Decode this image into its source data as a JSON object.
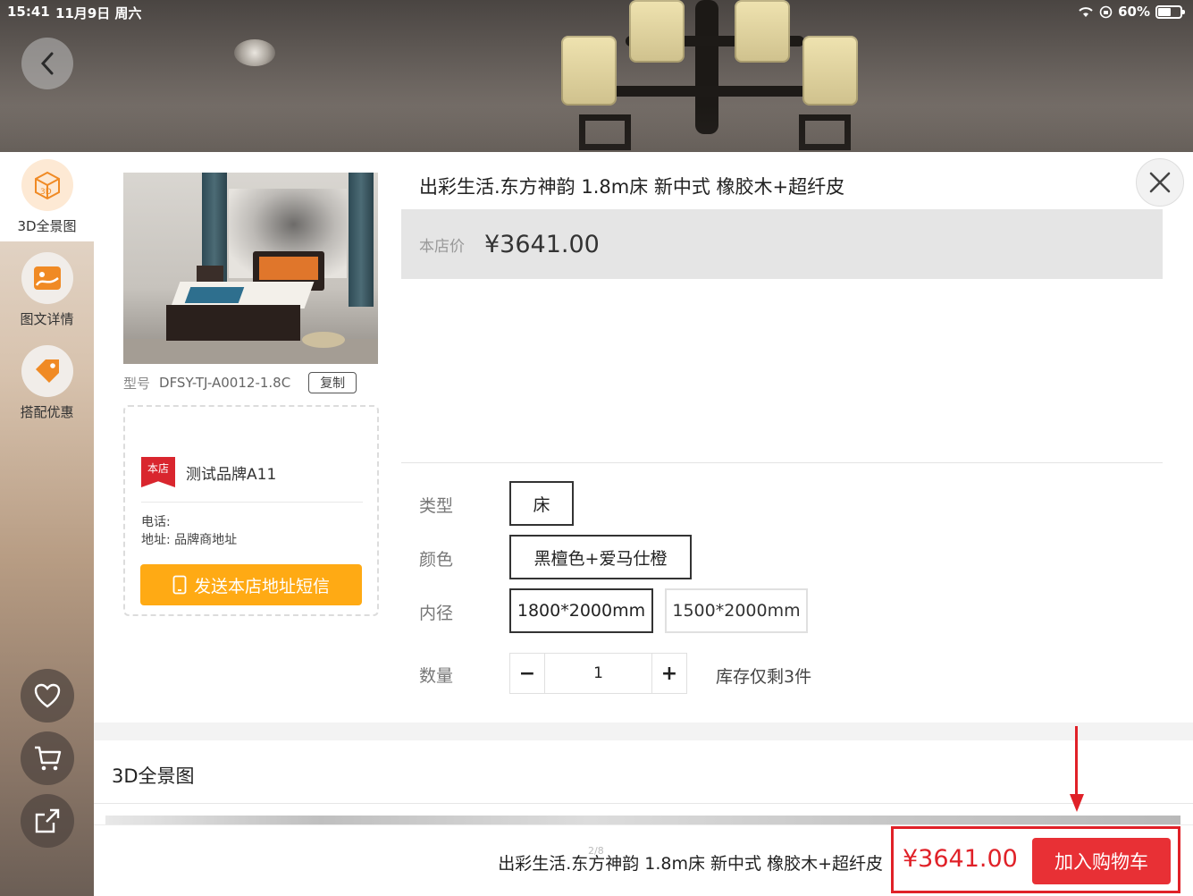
{
  "status_bar": {
    "time": "15:41",
    "date": "11月9日 周六",
    "battery": "60%",
    "battery_level": 0.6
  },
  "left_nav": {
    "tabs": [
      {
        "label": "3D全景图",
        "icon": "3d-cube-icon"
      },
      {
        "label": "图文详情",
        "icon": "image-icon"
      },
      {
        "label": "搭配优惠",
        "icon": "tag-icon"
      }
    ],
    "actions": [
      {
        "icon": "heart-icon"
      },
      {
        "icon": "cart-icon"
      },
      {
        "icon": "share-icon"
      }
    ]
  },
  "product": {
    "title": "出彩生活.东方神韵 1.8m床 新中式 橡胶木+超纤皮",
    "price_label": "本店价",
    "price": "¥3641.00",
    "model_label": "型号",
    "model_value": "DFSY-TJ-A0012-1.8C",
    "copy_label": "复制"
  },
  "store": {
    "badge": "本店",
    "brand": "测试品牌A11",
    "phone_label": "电话:",
    "address_label": "地址:",
    "address_value": "品牌商地址",
    "sms_button": "发送本店地址短信"
  },
  "specs": {
    "type_label": "类型",
    "type_options": [
      "床"
    ],
    "color_label": "颜色",
    "color_options": [
      "黑檀色+爱马仕橙"
    ],
    "size_label": "内径",
    "size_options": [
      "1800*2000mm",
      "1500*2000mm"
    ],
    "size_selected": "1800*2000mm",
    "quantity_label": "数量",
    "minus": "−",
    "plus": "+",
    "quantity": "1",
    "stock_note": "库存仅剩3件"
  },
  "section": {
    "title": "3D全景图"
  },
  "bottom_bar": {
    "title": "出彩生活.东方神韵 1.8m床 新中式 橡胶木+超纤皮",
    "page_indicator": "2/8",
    "price": "¥3641.00",
    "add_to_cart": "加入购物车"
  },
  "colors": {
    "accent_orange": "#ffaa14",
    "price_red": "#e02128",
    "cart_red": "#e83035"
  }
}
